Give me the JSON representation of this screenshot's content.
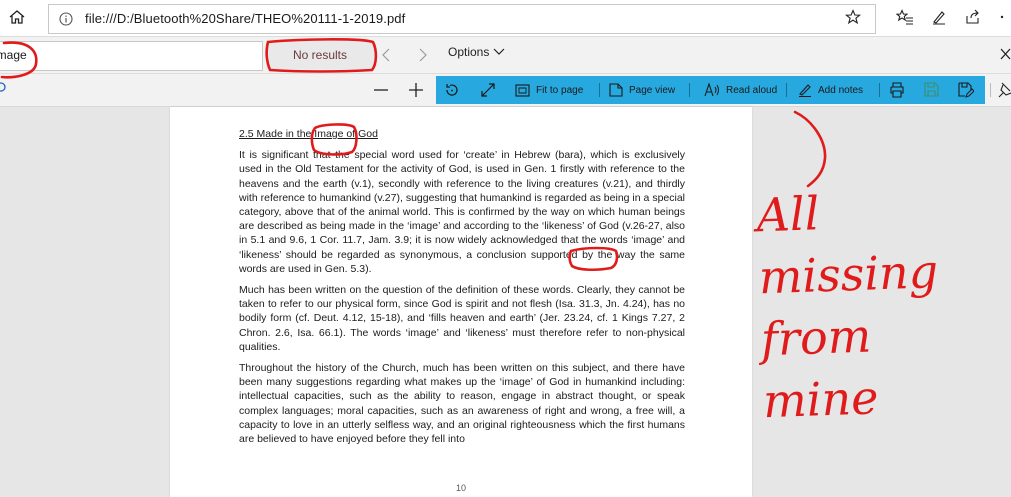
{
  "address_bar": {
    "url": "file:///D:/Bluetooth%20Share/THEO%20111-1-2019.pdf"
  },
  "find_bar": {
    "query": "image",
    "results": "No results",
    "options_label": "Options"
  },
  "pdf_toolbar": {
    "fit_to_page": "Fit to page",
    "page_view": "Page view",
    "read_aloud": "Read aloud",
    "add_notes": "Add notes"
  },
  "document": {
    "heading": "2.5 Made in the Image of God",
    "paragraphs": [
      "It is significant that the special word used for ‘create’ in Hebrew (bara), which is exclusively used in the Old Testament for the activity of God, is used in Gen. 1 firstly with reference to the heavens and the earth (v.1), secondly with reference to the living creatures (v.21), and thirdly with reference to humankind (v.27), suggesting that humankind is regarded as being in a special category, above that of the animal world. This is confirmed by the way on which human beings are described as being made in the ‘image’ and according to the ‘likeness’ of God (v.26-27, also in 5.1 and 9.6, 1 Cor. 11.7, Jam. 3.9; it is now widely acknowledged that the words ‘image’ and ‘likeness’ should be regarded as synonymous, a conclusion supported by the way the same words are used in Gen. 5.3).",
      "Much has been written on the question of the definition of these words. Clearly, they cannot be taken to refer to our physical form, since God is spirit and not flesh (Isa. 31.3, Jn. 4.24), has no bodily form (cf. Deut. 4.12, 15-18), and ‘fills heaven and earth’ (Jer. 23.24, cf. 1 Kings 7.27, 2 Chron. 2.6, Isa. 66.1). The words ‘image’ and ‘likeness’ must therefore refer to non-physical qualities.",
      "Throughout the history of the Church, much has been written on this subject, and there have been many suggestions regarding what makes up the ‘image’ of God in humankind including: intellectual capacities, such as the ability to reason, engage in abstract thought, or speak  complex languages; moral capacities, such as an awareness of right and wrong, a free will, a capacity to love in an utterly selfless way, and an original righteousness which the first humans are believed to have enjoyed before they fell into"
    ],
    "page_number": "10"
  },
  "annotation": {
    "handwritten_text": "All missing from mine",
    "color": "#e01b1b"
  },
  "colors": {
    "toolbar_highlight": "#27a8df",
    "annotation_red": "#e01b1b"
  }
}
